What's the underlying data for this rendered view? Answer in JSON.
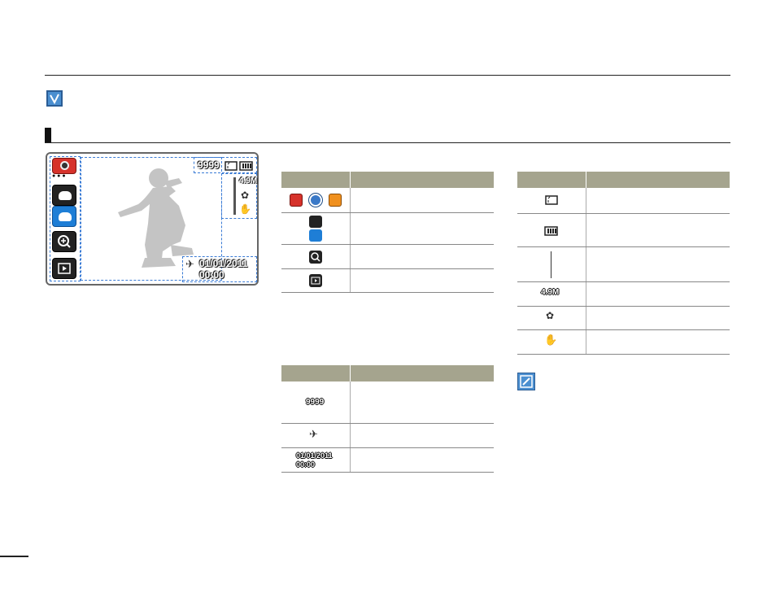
{
  "screen": {
    "counter": "9999",
    "resolution": "4.9M",
    "date": "01/01/2011",
    "time": "00:00"
  },
  "table_left_top": {
    "rows": [
      "mode-icons",
      "cloud-icons",
      "zoom-icon",
      "playback-icon"
    ]
  },
  "table_left_bottom": {
    "counter": "9999",
    "date": "01/01/2011",
    "time": "00:00"
  },
  "table_right": {
    "resolution": "4.9M"
  }
}
